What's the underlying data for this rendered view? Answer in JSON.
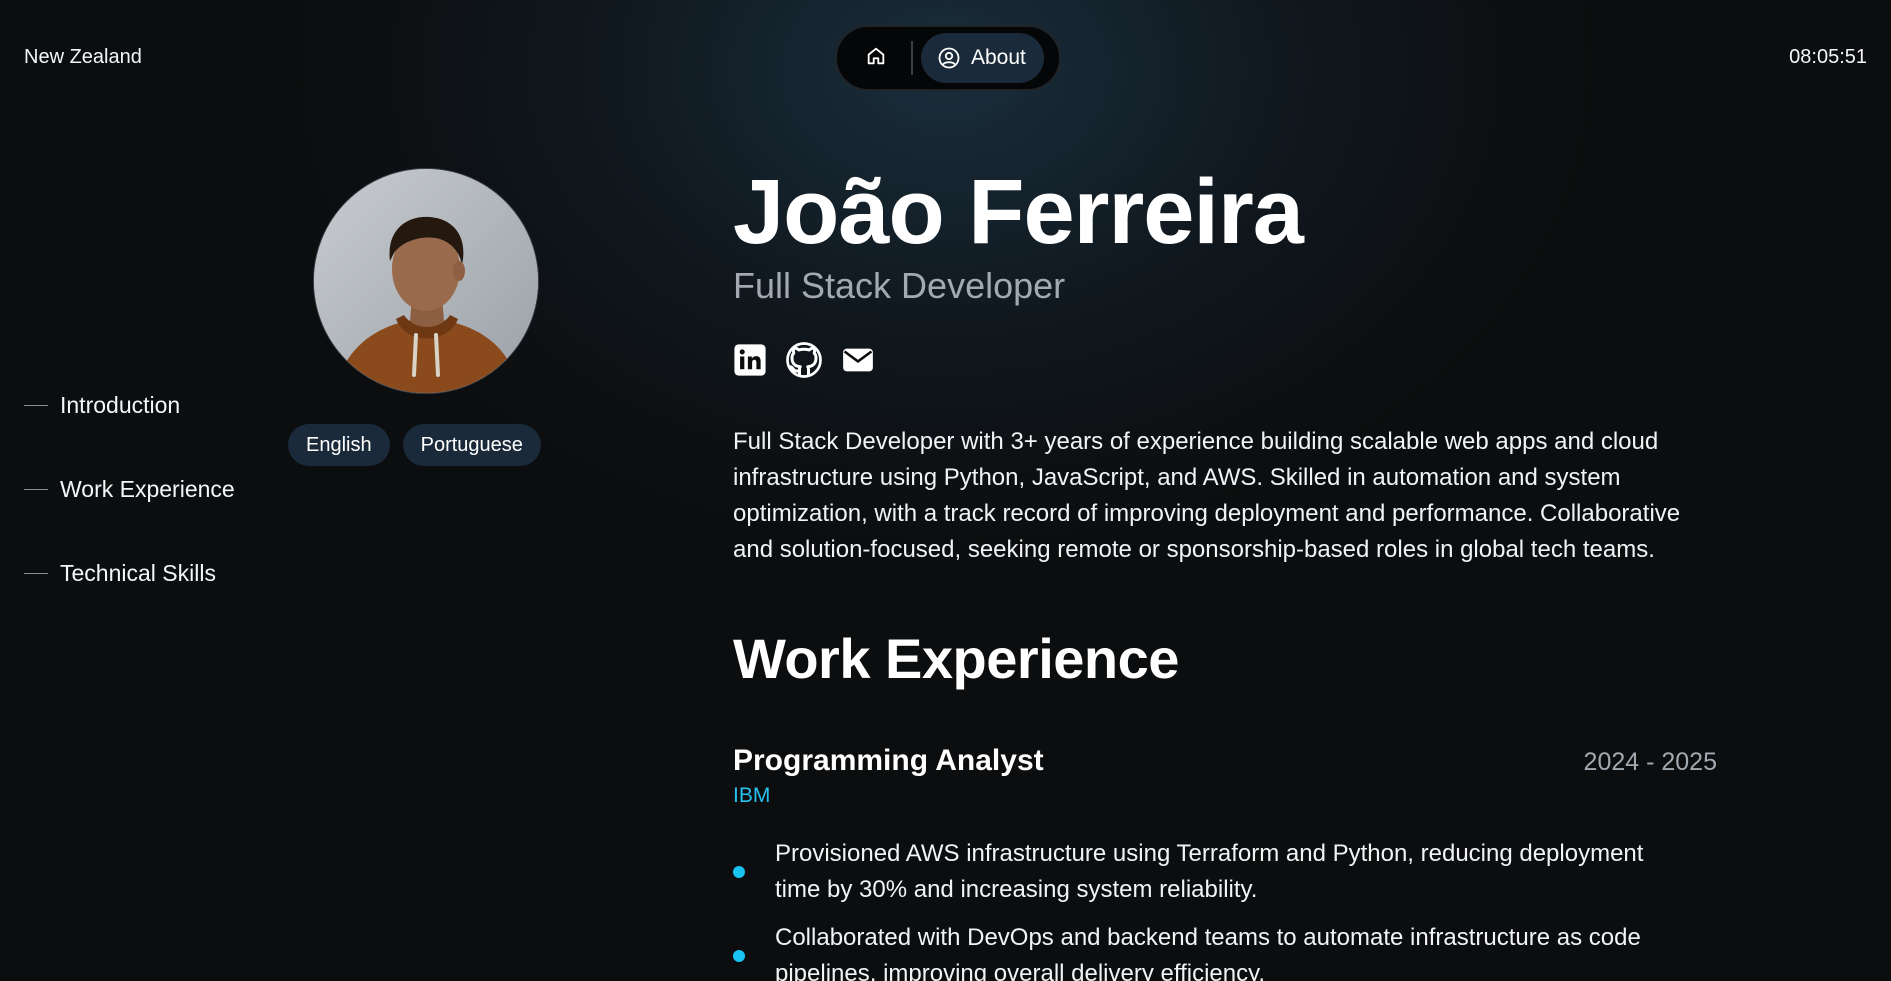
{
  "header": {
    "location": "New Zealand",
    "time": "08:05:51",
    "nav": {
      "home_icon": "home-icon",
      "about_icon": "user-circle-icon",
      "about_label": "About"
    }
  },
  "toc": {
    "items": [
      {
        "label": "Introduction"
      },
      {
        "label": "Work Experience"
      },
      {
        "label": "Technical Skills"
      }
    ]
  },
  "profile": {
    "name": "João Ferreira",
    "role": "Full Stack Developer",
    "languages": [
      "English",
      "Portuguese"
    ],
    "socials": [
      {
        "icon": "linkedin-icon"
      },
      {
        "icon": "github-icon"
      },
      {
        "icon": "mail-icon"
      }
    ],
    "summary": "Full Stack Developer with 3+ years of experience building scalable web apps and cloud infrastructure using Python, JavaScript, and AWS. Skilled in automation and system optimization, with a track record of improving deployment and performance. Collaborative and solution-focused, seeking remote or sponsorship-based roles in global tech teams."
  },
  "work": {
    "title": "Work Experience",
    "jobs": [
      {
        "title": "Programming Analyst",
        "dates": "2024 - 2025",
        "company": "IBM",
        "bullets": [
          "Provisioned AWS infrastructure using Terraform and Python, reducing deployment time by 30% and increasing system reliability.",
          "Collaborated with DevOps and backend teams to automate infrastructure as code pipelines, improving overall delivery efficiency."
        ]
      }
    ]
  },
  "colors": {
    "accent": "#27c1ee",
    "pill": "#1b2a3a",
    "background": "#0c0d0e"
  }
}
